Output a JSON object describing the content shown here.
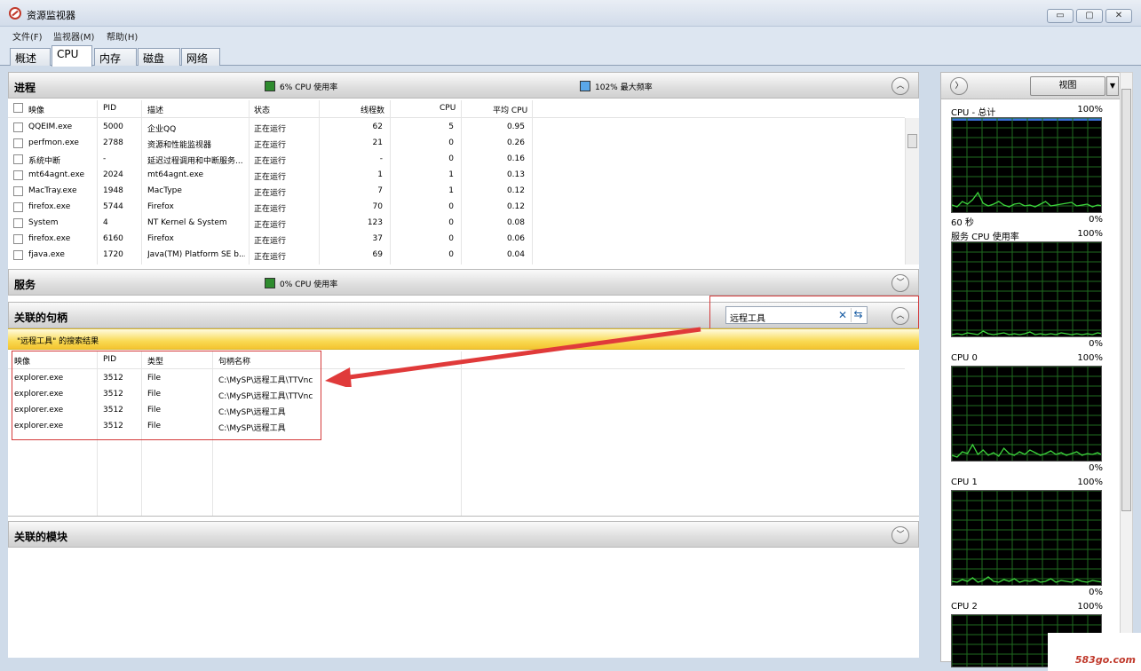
{
  "window": {
    "title": "资源监视器",
    "controls": [
      "▭",
      "▢",
      "✕"
    ]
  },
  "menu": [
    "文件(F)",
    "监视器(M)",
    "帮助(H)"
  ],
  "tabs": [
    "概述",
    "CPU",
    "内存",
    "磁盘",
    "网络"
  ],
  "active_tab": "CPU",
  "processes": {
    "title": "进程",
    "stat1": "6% CPU 使用率",
    "stat2": "102% 最大频率",
    "columns": [
      "映像",
      "PID",
      "描述",
      "状态",
      "线程数",
      "CPU",
      "平均 CPU"
    ],
    "rows": [
      [
        "QQEIM.exe",
        "5000",
        "企业QQ",
        "正在运行",
        "62",
        "5",
        "0.95"
      ],
      [
        "perfmon.exe",
        "2788",
        "资源和性能监视器",
        "正在运行",
        "21",
        "0",
        "0.26"
      ],
      [
        "系统中断",
        "-",
        "延迟过程调用和中断服务...",
        "正在运行",
        "-",
        "0",
        "0.16"
      ],
      [
        "mt64agnt.exe",
        "2024",
        "mt64agnt.exe",
        "正在运行",
        "1",
        "1",
        "0.13"
      ],
      [
        "MacTray.exe",
        "1948",
        "MacType",
        "正在运行",
        "7",
        "1",
        "0.12"
      ],
      [
        "firefox.exe",
        "5744",
        "Firefox",
        "正在运行",
        "70",
        "0",
        "0.12"
      ],
      [
        "System",
        "4",
        "NT Kernel & System",
        "正在运行",
        "123",
        "0",
        "0.08"
      ],
      [
        "firefox.exe",
        "6160",
        "Firefox",
        "正在运行",
        "37",
        "0",
        "0.06"
      ],
      [
        "fjava.exe",
        "1720",
        "Java(TM) Platform SE b...",
        "正在运行",
        "69",
        "0",
        "0.04"
      ]
    ]
  },
  "services": {
    "title": "服务",
    "stat": "0% CPU 使用率"
  },
  "handles": {
    "title": "关联的句柄",
    "search_value": "远程工具",
    "result_text": "\"远程工具\" 的搜索结果",
    "columns": [
      "映像",
      "PID",
      "类型",
      "句柄名称"
    ],
    "rows": [
      [
        "explorer.exe",
        "3512",
        "File",
        "C:\\MySP\\远程工具\\TTVnc"
      ],
      [
        "explorer.exe",
        "3512",
        "File",
        "C:\\MySP\\远程工具\\TTVnc"
      ],
      [
        "explorer.exe",
        "3512",
        "File",
        "C:\\MySP\\远程工具"
      ],
      [
        "explorer.exe",
        "3512",
        "File",
        "C:\\MySP\\远程工具"
      ]
    ]
  },
  "modules": {
    "title": "关联的模块"
  },
  "right_panel": {
    "view_label": "视图",
    "graphs": [
      {
        "title": "CPU - 总计",
        "max": "100%",
        "left_label": "60 秒",
        "min": "0%"
      },
      {
        "title": "服务 CPU 使用率",
        "max": "100%",
        "left_label": "",
        "min": "0%"
      },
      {
        "title": "CPU 0",
        "max": "100%",
        "left_label": "",
        "min": "0%"
      },
      {
        "title": "CPU 1",
        "max": "100%",
        "left_label": "",
        "min": "0%"
      },
      {
        "title": "CPU 2",
        "max": "100%",
        "left_label": "",
        "min": ""
      }
    ]
  },
  "watermark": "583go.com",
  "colors": {
    "highlight_red": "#d43a3a",
    "graph_green": "#3cd33c",
    "graph_bg": "#000000",
    "cpu_stat": "#2e8b2e",
    "freq_stat": "#5aa7e8"
  }
}
